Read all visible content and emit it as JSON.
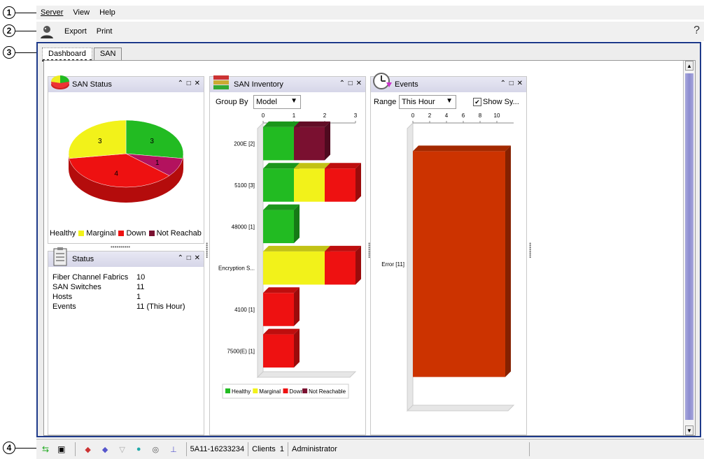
{
  "callouts": [
    "1",
    "2",
    "3",
    "4"
  ],
  "menu": {
    "items": [
      "Server",
      "View",
      "Help"
    ]
  },
  "toolbar": {
    "export": "Export",
    "print": "Print",
    "help_icon": "question-icon"
  },
  "tabs": [
    {
      "label": "Dashboard",
      "active": true
    },
    {
      "label": "SAN",
      "active": false
    }
  ],
  "san_status": {
    "title": "SAN Status",
    "controls": "⌃ □ ✕",
    "slices": [
      {
        "name": "Healthy",
        "value": 3,
        "color": "#22bb22"
      },
      {
        "name": "Not Reachable",
        "value": 1,
        "color": "#b3125e"
      },
      {
        "name": "Down",
        "value": 4,
        "color": "#ee1111"
      },
      {
        "name": "Marginal",
        "value": 3,
        "color": "#f2f21a"
      }
    ],
    "legend": [
      {
        "label": "Healthy",
        "color": "#22bb22"
      },
      {
        "label": "Marginal",
        "color": "#f2f21a"
      },
      {
        "label": "Down",
        "color": "#ee1111"
      },
      {
        "label": "Not Reachab",
        "color": "#7a1030"
      }
    ]
  },
  "status": {
    "title": "Status",
    "rows": [
      {
        "label": "Fiber Channel Fabrics",
        "value": "10"
      },
      {
        "label": "SAN Switches",
        "value": "11"
      },
      {
        "label": "Hosts",
        "value": "1"
      },
      {
        "label": "Events",
        "value": "11 (This Hour)"
      }
    ]
  },
  "inventory": {
    "title": "SAN Inventory",
    "group_by_label": "Group By",
    "group_by_value": "Model",
    "legend": [
      {
        "label": "Healthy",
        "color": "#22bb22"
      },
      {
        "label": "Marginal",
        "color": "#f2f21a"
      },
      {
        "label": "Down",
        "color": "#ee1111"
      },
      {
        "label": "Not Reachable",
        "color": "#7a1030"
      }
    ],
    "chart_data": {
      "type": "bar",
      "orientation": "horizontal",
      "stacked": true,
      "categories": [
        "200E [2]",
        "5100 [3]",
        "48000 [1]",
        "Encryption S...",
        "4100 [1]",
        "7500(E) [1]"
      ],
      "xticks": [
        "0",
        "1",
        "2",
        "3"
      ],
      "xlim": [
        0,
        3
      ],
      "series": [
        {
          "name": "Healthy",
          "color": "#22bb22",
          "values": [
            1,
            1,
            1,
            0,
            0,
            0
          ]
        },
        {
          "name": "Marginal",
          "color": "#f2f21a",
          "values": [
            0,
            1,
            0,
            2,
            0,
            0
          ]
        },
        {
          "name": "Down",
          "color": "#ee1111",
          "values": [
            0,
            1,
            0,
            1,
            1,
            1
          ]
        },
        {
          "name": "Not Reachable",
          "color": "#7a1030",
          "values": [
            1,
            0,
            0,
            0,
            0,
            0
          ]
        }
      ]
    }
  },
  "events": {
    "title": "Events",
    "range_label": "Range",
    "range_value": "This Hour",
    "show_sys_label": "Show Sy...",
    "show_sys_checked": true,
    "chart_data": {
      "type": "bar",
      "orientation": "horizontal",
      "categories": [
        "Error [11]"
      ],
      "xticks": [
        "0",
        "2",
        "4",
        "6",
        "8",
        "10"
      ],
      "xlim": [
        0,
        12
      ],
      "series": [
        {
          "name": "Error",
          "color": "#cc3300",
          "values": [
            11
          ]
        }
      ]
    }
  },
  "statusbar": {
    "server": "5A11-16233234",
    "clients_label": "Clients",
    "clients_count": "1",
    "user": "Administrator"
  }
}
